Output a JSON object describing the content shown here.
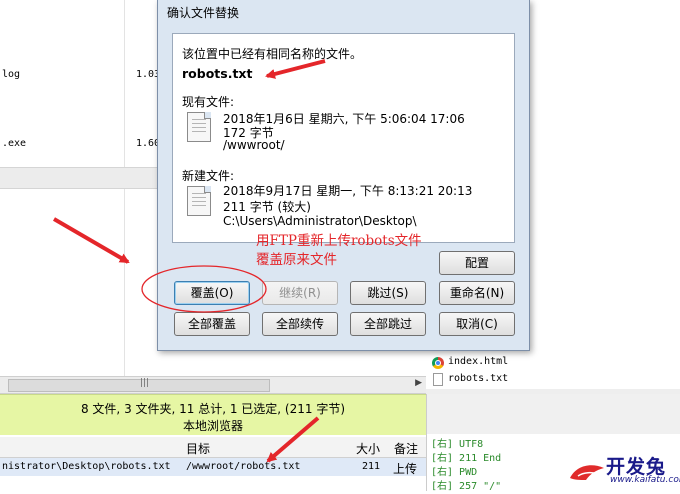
{
  "dialog": {
    "title": "确认文件替换",
    "message": "该位置中已经有相同名称的文件。",
    "filename": "robots.txt",
    "existing": {
      "heading": "现有文件:",
      "date": "2018年1月6日 星期六, 下午 5:06:04 17:06",
      "size": "172 字节",
      "path": "/wwwroot/"
    },
    "new_file": {
      "heading": "新建文件:",
      "date": "2018年9月17日 星期一, 下午 8:13:21 20:13",
      "size": "211 字节 (较大)",
      "path": "C:\\Users\\Administrator\\Desktop\\"
    },
    "buttons": {
      "configure": "配置",
      "overwrite": "覆盖(O)",
      "continue": "继续(R)",
      "skip": "跳过(S)",
      "rename": "重命名(N)",
      "overwrite_all": "全部覆盖",
      "continue_all": "全部续传",
      "skip_all": "全部跳过",
      "cancel": "取消(C)"
    }
  },
  "annotation": {
    "line1": "用FTP重新上传robots文件",
    "line2": "覆盖原来文件"
  },
  "background": {
    "left_files": [
      {
        "name": "log",
        "size": "1.03"
      },
      {
        "name": ".exe",
        "size": "1.60"
      }
    ],
    "status_line": "8 文件, 3 文件夹, 11 总计, 1 已选定, (211 字节)",
    "status_label": "本地浏览器",
    "right_files": [
      "index.html",
      "robots.txt"
    ],
    "queue_columns": {
      "target": "目标",
      "size": "大小",
      "note": "备注"
    },
    "queue_row": {
      "source": "nistrator\\Desktop\\robots.txt",
      "target": "/wwwroot/robots.txt",
      "size": "211",
      "note": "上传到"
    },
    "log_lines": [
      "[右] UTF8",
      "[右] 211 End",
      "[右] PWD",
      "[右] 257 \"/\""
    ]
  },
  "logo": {
    "brand": "开发兔",
    "site": "www.kaifatu.com"
  },
  "colors": {
    "status_bar": "#e6f6a4",
    "annotation_red": "#e4262a",
    "dialog_frame": "#dbe6f2"
  }
}
